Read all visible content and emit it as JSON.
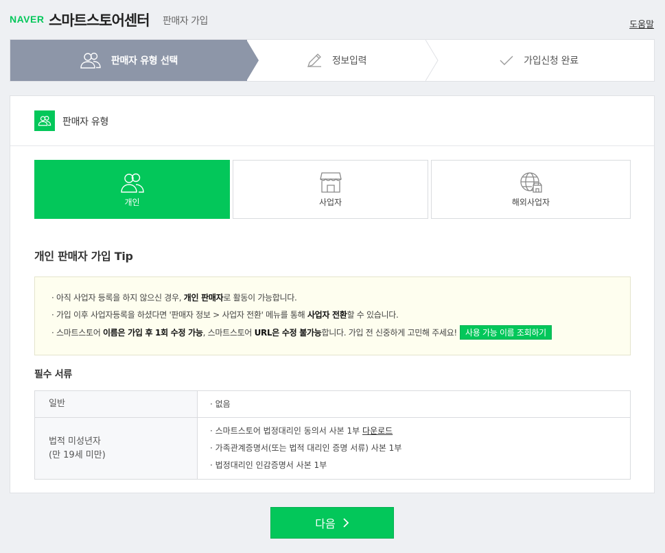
{
  "header": {
    "logo": "NAVER",
    "brand": "스마트스토어센터",
    "subtitle": "판매자 가입",
    "help_link": "도움말"
  },
  "steps": [
    {
      "label": "판매자 유형 선택",
      "active": true,
      "icon": "users-icon"
    },
    {
      "label": "정보입력",
      "active": false,
      "icon": "pencil-icon"
    },
    {
      "label": "가입신청 완료",
      "active": false,
      "icon": "check-icon"
    }
  ],
  "section": {
    "title": "판매자 유형",
    "icon": "users-icon"
  },
  "seller_types": [
    {
      "label": "개인",
      "selected": true,
      "icon": "person-icon"
    },
    {
      "label": "사업자",
      "selected": false,
      "icon": "store-icon"
    },
    {
      "label": "해외사업자",
      "selected": false,
      "icon": "globe-store-icon"
    }
  ],
  "tip": {
    "title": "개인 판매자 가입 Tip",
    "line1_a": "· 아직 사업자 등록을 하지 않으신 경우, ",
    "line1_b": "개인 판매자",
    "line1_c": "로 활동이 가능합니다.",
    "line2_a": "· 가입 이후 사업자등록을 하셨다면 '판매자 정보 > 사업자 전환' 메뉴를 통해 ",
    "line2_b": "사업자 전환",
    "line2_c": "할 수 있습니다.",
    "line3_a": "· 스마트스토어 ",
    "line3_b": "이름은 가입 후 1회 수정 가능",
    "line3_c": ", 스마트스토어 ",
    "line3_d": "URL은 수정 불가능",
    "line3_e": "합니다. 가입 전 신중하게 고민해 주세요!",
    "button": "사용 가능 이름 조회하기"
  },
  "required": {
    "title": "필수 서류",
    "rows": [
      {
        "header": "일반",
        "header2": "",
        "items": [
          "· 없음"
        ]
      },
      {
        "header": "법적 미성년자",
        "header2": "(만 19세 미만)",
        "items": [
          "· 스마트스토어 법정대리인 동의서 사본 1부 ",
          "· 가족관계증명서(또는 법적 대리인 증명 서류) 사본 1부",
          "· 법정대리인 인감증명서 사본 1부"
        ],
        "download": "다운로드"
      }
    ]
  },
  "next_button": "다음",
  "colors": {
    "accent": "#03c75a",
    "step_active": "#8d96a8",
    "tip_bg": "#fefeef"
  }
}
